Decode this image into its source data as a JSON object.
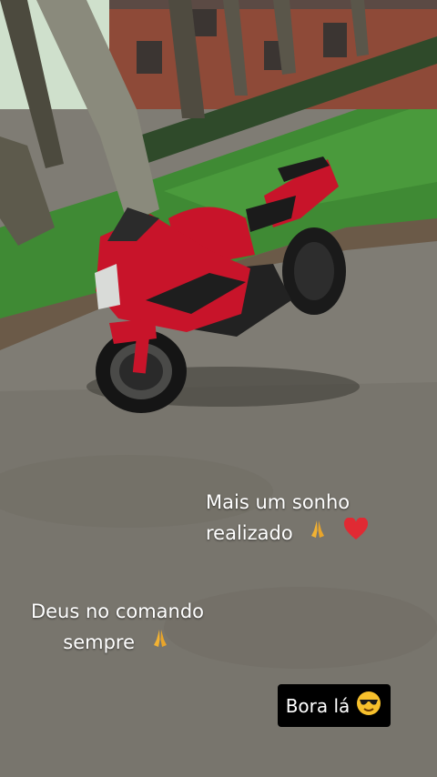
{
  "photo": {
    "subject": "red sport motorcycle parked on wet pavement",
    "colors": {
      "bike": "#c8142a",
      "grass": "#3f8a34",
      "pavement": "#7f7c74",
      "building": "#8e4a38"
    }
  },
  "captions": {
    "first": {
      "line1": "Mais um sonho",
      "line2": "realizado",
      "emojis": [
        "praying-hands",
        "red-heart"
      ]
    },
    "second": {
      "line1": "Deus no comando",
      "line2": "sempre",
      "emojis": [
        "praying-hands"
      ]
    }
  },
  "sticker": {
    "text": "Bora lá",
    "emoji": "sunglasses-face",
    "background": "#000000"
  }
}
